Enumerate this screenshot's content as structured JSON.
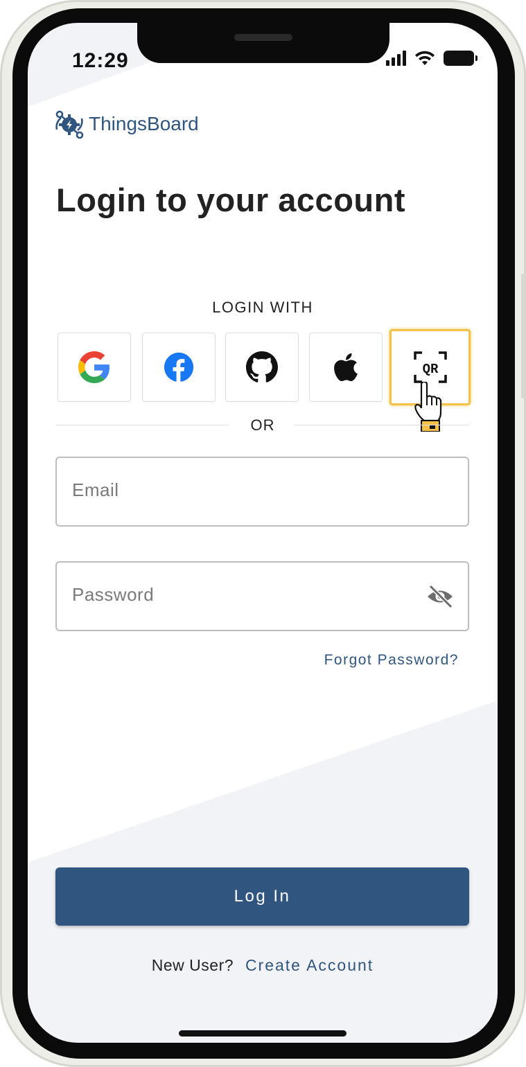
{
  "status_bar": {
    "time": "12:29"
  },
  "brand": {
    "name": "ThingsBoard",
    "color": "#305680"
  },
  "page": {
    "title": "Login to your account"
  },
  "social": {
    "heading": "LOGIN WITH",
    "providers": [
      {
        "id": "google",
        "icon": "google-icon"
      },
      {
        "id": "facebook",
        "icon": "facebook-icon"
      },
      {
        "id": "github",
        "icon": "github-icon"
      },
      {
        "id": "apple",
        "icon": "apple-icon"
      },
      {
        "id": "qr",
        "icon": "qr-code-icon",
        "label": "QR",
        "highlighted": true,
        "highlight_color": "#f4c24a"
      }
    ]
  },
  "divider": {
    "text": "OR"
  },
  "form": {
    "email": {
      "placeholder": "Email",
      "value": ""
    },
    "password": {
      "placeholder": "Password",
      "value": "",
      "visibility_icon": "eye-off-icon"
    },
    "forgot_password": "Forgot Password?",
    "submit": "Log In"
  },
  "footer": {
    "prompt": "New User?",
    "link": "Create Account"
  }
}
